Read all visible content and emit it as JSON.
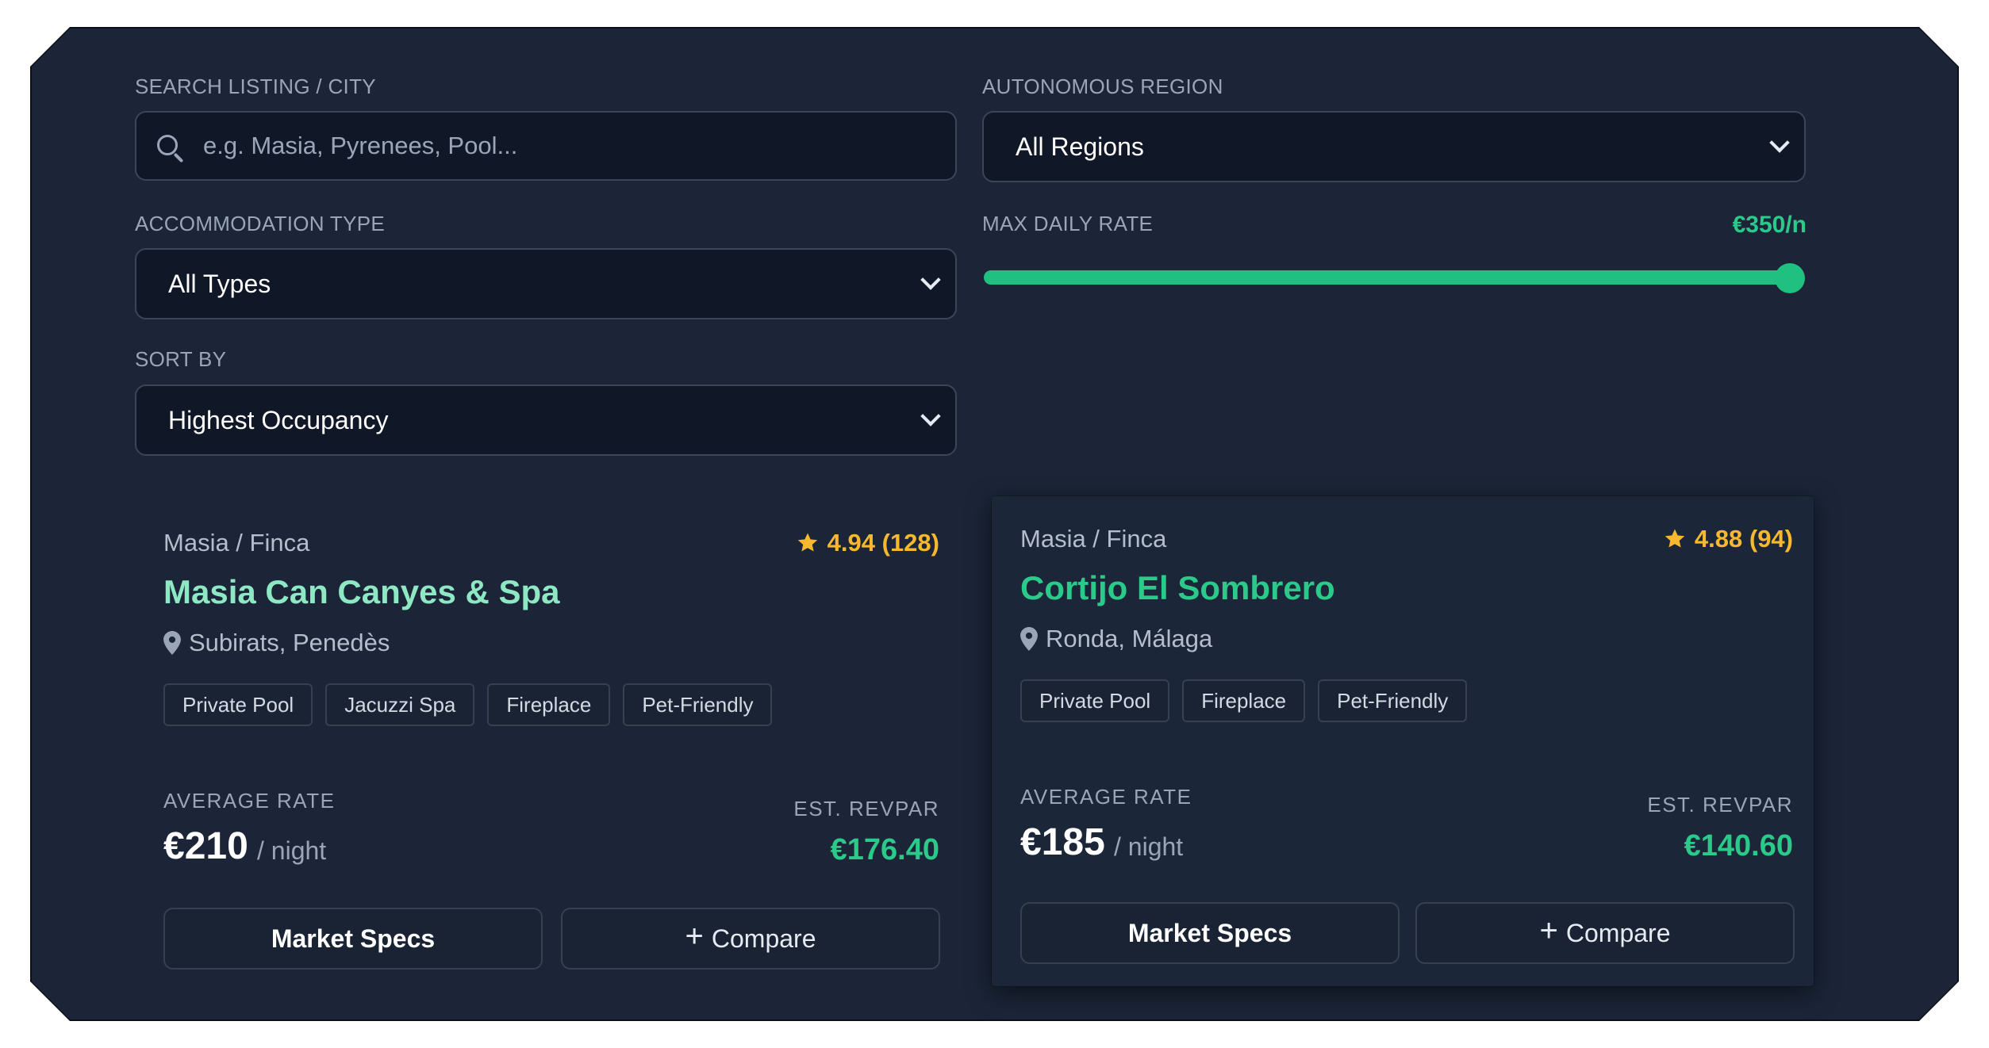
{
  "filters": {
    "search_label": "SEARCH LISTING / CITY",
    "search_placeholder": "e.g. Masia, Pyrenees, Pool...",
    "region_label": "AUTONOMOUS REGION",
    "region_value": "All Regions",
    "type_label": "ACCOMMODATION TYPE",
    "type_value": "All Types",
    "rate_label": "MAX DAILY RATE",
    "rate_value": "€350/n",
    "rate_fraction": 1.0,
    "sort_label": "SORT BY",
    "sort_value": "Highest Occupancy"
  },
  "colors": {
    "background": "#1b2537",
    "accent": "#1fc080",
    "title_light": "#8ee8c4",
    "title_green": "#2bc98a",
    "rating": "#f5b82e"
  },
  "listings": [
    {
      "type": "Masia / Finca",
      "rating": "4.94 (128)",
      "title": "Masia Can Canyes & Spa",
      "location": "Subirats, Penedès",
      "tags": [
        "Private Pool",
        "Jacuzzi Spa",
        "Fireplace",
        "Pet-Friendly"
      ],
      "avg_label": "AVERAGE RATE",
      "price": "€210",
      "per_night": "/ night",
      "revpar_label": "EST. REVPAR",
      "revpar": "€176.40",
      "specs_button": "Market Specs",
      "compare_button": "Compare"
    },
    {
      "type": "Masia / Finca",
      "rating": "4.88 (94)",
      "title": "Cortijo El Sombrero",
      "location": "Ronda, Málaga",
      "tags": [
        "Private Pool",
        "Fireplace",
        "Pet-Friendly"
      ],
      "avg_label": "AVERAGE RATE",
      "price": "€185",
      "per_night": "/ night",
      "revpar_label": "EST. REVPAR",
      "revpar": "€140.60",
      "specs_button": "Market Specs",
      "compare_button": "Compare"
    }
  ]
}
